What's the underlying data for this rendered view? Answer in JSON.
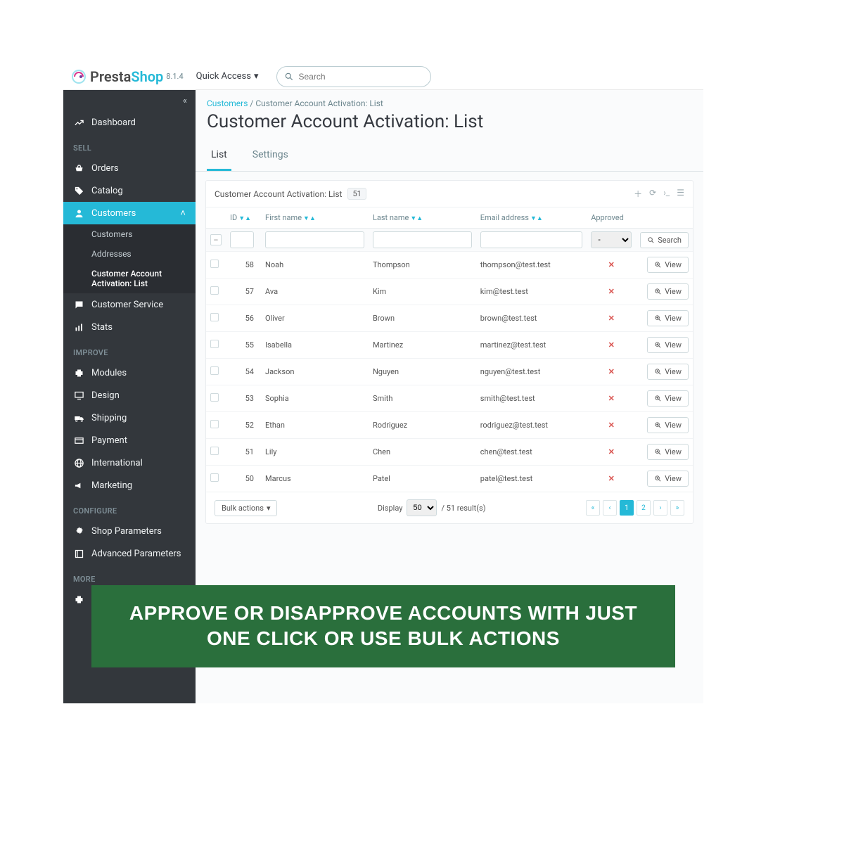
{
  "brand": {
    "name1": "Presta",
    "name2": "Shop",
    "version": "8.1.4"
  },
  "topbar": {
    "quick_access": "Quick Access",
    "search_placeholder": "Search"
  },
  "sidebar": {
    "collapse_icon": "«",
    "dashboard": "Dashboard",
    "sections": {
      "sell": "SELL",
      "improve": "IMPROVE",
      "configure": "CONFIGURE",
      "more": "MORE"
    },
    "sell_items": {
      "orders": "Orders",
      "catalog": "Catalog",
      "customers": "Customers",
      "customer_service": "Customer Service",
      "stats": "Stats"
    },
    "customers_sub": {
      "customers": "Customers",
      "addresses": "Addresses",
      "activation": "Customer Account Activation: List"
    },
    "improve_items": {
      "modules": "Modules",
      "design": "Design",
      "shipping": "Shipping",
      "payment": "Payment",
      "international": "International",
      "marketing": "Marketing"
    },
    "configure_items": {
      "shop_params": "Shop Parameters",
      "adv_params": "Advanced Parameters"
    }
  },
  "breadcrumb": {
    "root": "Customers",
    "sep": "/",
    "leaf": "Customer Account Activation: List"
  },
  "page_title": "Customer Account Activation: List",
  "tabs": {
    "list": "List",
    "settings": "Settings"
  },
  "panel": {
    "title": "Customer Account Activation: List",
    "count": "51",
    "columns": {
      "id": "ID",
      "first": "First name",
      "last": "Last name",
      "email": "Email address",
      "approved": "Approved"
    },
    "search_btn": "Search",
    "view_btn": "View",
    "approved_filter_options": [
      "-"
    ],
    "bulk_label": "Bulk actions",
    "display_label": "Display",
    "per_page": "50",
    "results_suffix": "/ 51 result(s)",
    "pages": [
      "«",
      "‹",
      "1",
      "2",
      "›",
      "»"
    ],
    "rows": [
      {
        "id": "58",
        "first": "Noah",
        "last": "Thompson",
        "email": "thompson@test.test",
        "approved": false
      },
      {
        "id": "57",
        "first": "Ava",
        "last": "Kim",
        "email": "kim@test.test",
        "approved": false
      },
      {
        "id": "56",
        "first": "Oliver",
        "last": "Brown",
        "email": "brown@test.test",
        "approved": false
      },
      {
        "id": "55",
        "first": "Isabella",
        "last": "Martinez",
        "email": "martinez@test.test",
        "approved": false
      },
      {
        "id": "54",
        "first": "Jackson",
        "last": "Nguyen",
        "email": "nguyen@test.test",
        "approved": false
      },
      {
        "id": "53",
        "first": "Sophia",
        "last": "Smith",
        "email": "smith@test.test",
        "approved": false
      },
      {
        "id": "52",
        "first": "Ethan",
        "last": "Rodriguez",
        "email": "rodriguez@test.test",
        "approved": false
      },
      {
        "id": "51",
        "first": "Lily",
        "last": "Chen",
        "email": "chen@test.test",
        "approved": false
      },
      {
        "id": "50",
        "first": "Marcus",
        "last": "Patel",
        "email": "patel@test.test",
        "approved": false
      }
    ]
  },
  "banner": "APPROVE OR DISAPPROVE ACCOUNTS WITH JUST ONE CLICK OR USE BULK ACTIONS"
}
